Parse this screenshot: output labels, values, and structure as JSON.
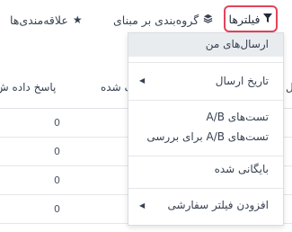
{
  "toolbar": {
    "filters_label": "فیلترها",
    "filters_icon": "funnel-icon",
    "groupby_label": "گروه‌بندی بر مبنای",
    "groupby_icon": "layers-icon",
    "favorites_label": "علاقه‌مندی‌ها",
    "favorites_icon": "star-icon"
  },
  "table": {
    "headers": {
      "col_a": "ل",
      "col_b": "ک شده (%)",
      "col_c": "پاسخ داده ش"
    },
    "rows": [
      {
        "value": "0"
      },
      {
        "value": "0"
      },
      {
        "value": "0"
      },
      {
        "value": "0"
      }
    ]
  },
  "filters_menu": {
    "items": {
      "my_mailings": "ارسال‌های من",
      "send_date": "تاریخ ارسال",
      "ab_tests": "تست‌های A/B",
      "ab_tests_review": "تست‌های A/B برای بررسی",
      "archived": "بایگانی شده",
      "add_custom_filter": "افزودن فیلتر سفارشی"
    }
  }
}
